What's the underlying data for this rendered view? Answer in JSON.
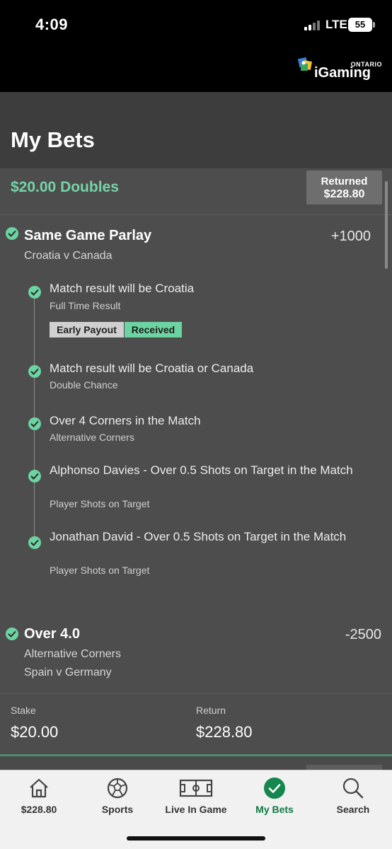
{
  "status_bar": {
    "time": "4:09",
    "network": "LTE",
    "battery": "55"
  },
  "brand": {
    "logo_small": "ONTARIO",
    "logo_main": "iGaming"
  },
  "header": {
    "title": "My Bets"
  },
  "bet": {
    "type": "$20.00 Doubles",
    "returned_label": "Returned",
    "returned_value": "$228.80",
    "selections": [
      {
        "title": "Same Game Parlay",
        "odds": "+1000",
        "subtitle": "Croatia v Canada",
        "legs": [
          {
            "title": "Match result will be Croatia",
            "sub": "Full Time Result"
          },
          {
            "title": "Match result will be Croatia or Canada",
            "sub": "Double Chance"
          },
          {
            "title": "Over 4 Corners in the Match",
            "sub": "Alternative Corners"
          },
          {
            "title": "Alphonso Davies - Over 0.5 Shots on Target in the Match",
            "sub": "Player Shots on Target"
          },
          {
            "title": "Jonathan David - Over 0.5 Shots on Target in the Match",
            "sub": "Player Shots on Target"
          }
        ],
        "badges": {
          "early": "Early Payout",
          "received": "Received"
        }
      },
      {
        "title": "Over 4.0",
        "odds": "-2500",
        "subtitle": "Alternative Corners",
        "subtitle2": "Spain v Germany"
      }
    ],
    "stake_label": "Stake",
    "stake_value": "$20.00",
    "return_label": "Return",
    "return_value": "$228.80"
  },
  "nav": {
    "items": [
      {
        "label": "$228.80",
        "icon": "home-icon"
      },
      {
        "label": "Sports",
        "icon": "soccer-ball-icon"
      },
      {
        "label": "Live In Game",
        "icon": "pitch-icon"
      },
      {
        "label": "My Bets",
        "icon": "check-circle-icon"
      },
      {
        "label": "Search",
        "icon": "search-icon"
      }
    ]
  },
  "colors": {
    "accent_green": "#6cd3a2",
    "active_nav": "#0f7a44"
  }
}
